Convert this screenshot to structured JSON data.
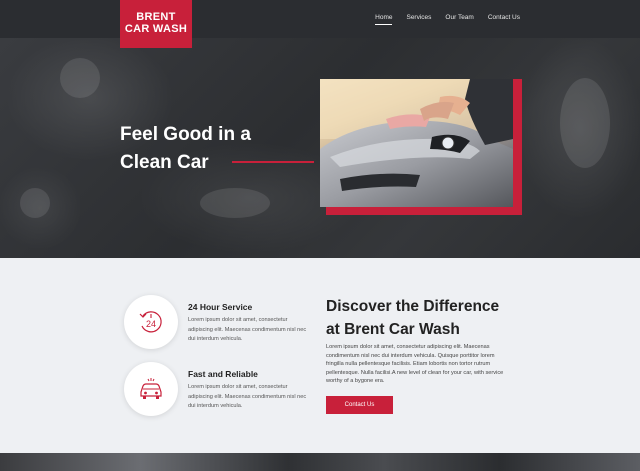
{
  "brand": {
    "line1": "BRENT",
    "line2": "CAR WASH"
  },
  "nav": {
    "items": [
      {
        "label": "Home",
        "active": true
      },
      {
        "label": "Services",
        "active": false
      },
      {
        "label": "Our Team",
        "active": false
      },
      {
        "label": "Contact Us",
        "active": false
      }
    ]
  },
  "hero": {
    "title_line1": "Feel Good in a",
    "title_line2": "Clean Car"
  },
  "features": [
    {
      "icon": "24-hour-clock-icon",
      "title": "24 Hour Service",
      "text": "Lorem ipsum dolor sit amet, consectetur adipiscing elit. Maecenas condimentum nisl nec dui interdum vehicula."
    },
    {
      "icon": "car-icon",
      "title": "Fast and Reliable",
      "text": "Lorem ipsum dolor sit amet, consectetur adipiscing elit. Maecenas condimentum nisl nec dui interdum vehicula."
    }
  ],
  "discover": {
    "title_line1": "Discover the Difference",
    "title_line2": "at Brent Car Wash",
    "text": "Lorem ipsum dolor sit amet, consectetur adipiscing elit. Maecenas condimentum nisl nec dui interdum vehicula. Quisque porttitor lorem fringilla nulla pellentesque facilisis. Etiam lobortis non tortor rutrum pellentesque. Nulla facilisi.A new level of clean for your car, with service worthy of a bygone era.",
    "cta_label": "Contact Us"
  },
  "colors": {
    "accent": "#c8203a",
    "header_bg": "#2b2d31",
    "section_bg": "#eef0f3"
  }
}
